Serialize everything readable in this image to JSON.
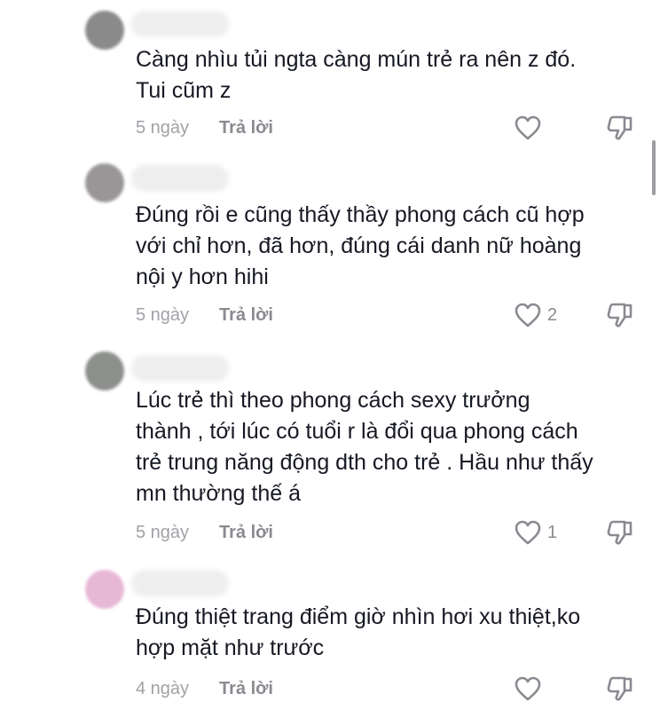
{
  "comments": [
    {
      "text": "Càng nhìu tủi ngta càng mún trẻ ra nên z đó.\nTui cũm z",
      "date": "5 ngày",
      "reply_label": "Trả lời",
      "likes": "",
      "avatar_color": "#8a8a8a"
    },
    {
      "text": "Đúng rồi e cũng thấy thầy phong cách cũ hợp\nvới chỉ hơn, đã hơn, đúng cái danh nữ hoàng\nnội y hơn hihi",
      "date": "5 ngày",
      "reply_label": "Trả lời",
      "likes": "2",
      "avatar_color": "#9a9698"
    },
    {
      "text": "Lúc trẻ thì theo phong cách sexy trưởng\nthành , tới lúc có tuổi r là đổi qua phong cách\ntrẻ trung năng động dth cho trẻ . Hầu như thấy\nmn thường thế á",
      "date": "5 ngày",
      "reply_label": "Trả lời",
      "likes": "1",
      "avatar_color": "#8c8f8c"
    },
    {
      "text": "Đúng thiệt trang điểm giờ nhìn hơi xu thiệt,ko\nhợp mặt như trước",
      "date": "4 ngày",
      "reply_label": "Trả lời",
      "likes": "",
      "avatar_color": "#e7b8d6"
    }
  ],
  "icons": {
    "like": "heart-outline-icon",
    "dislike": "thumbs-down-icon"
  },
  "colors": {
    "text": "#161823",
    "meta": "#8a8b91",
    "date": "#a1a2a7"
  }
}
